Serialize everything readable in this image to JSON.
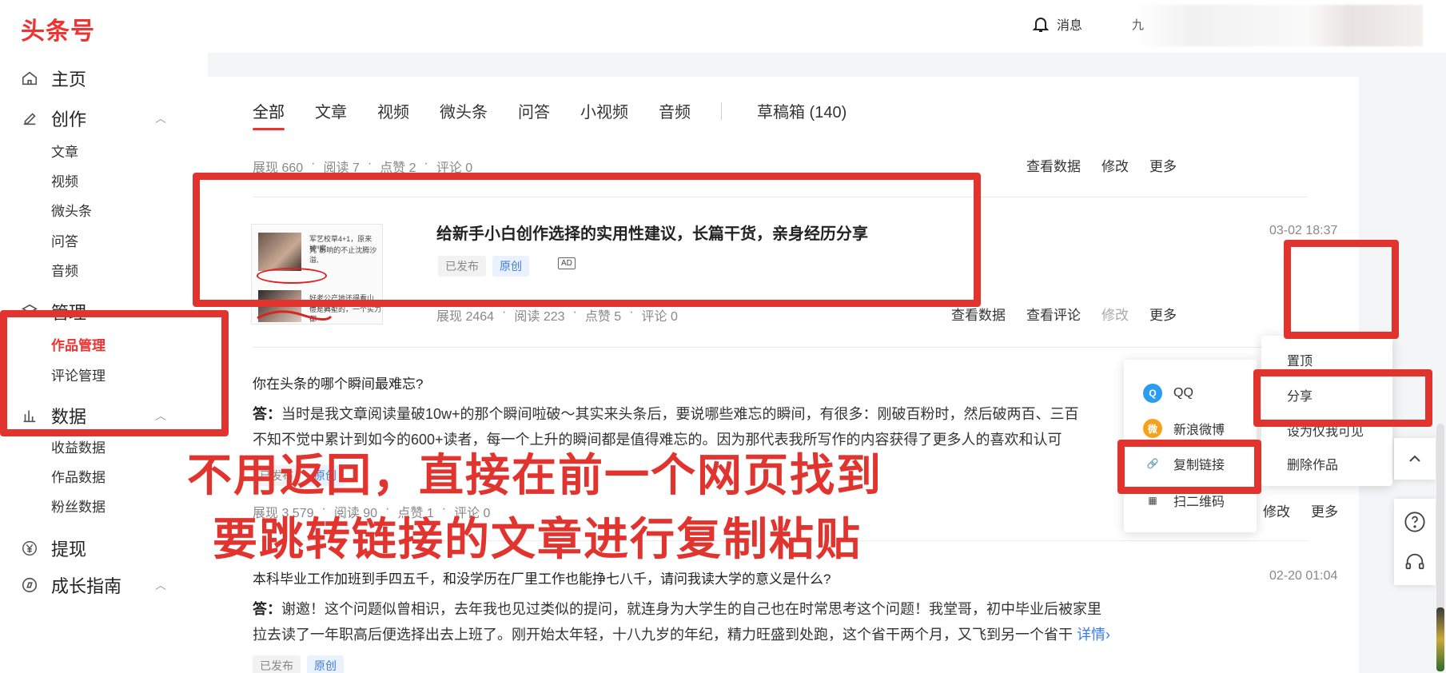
{
  "header": {
    "logo": "头条号",
    "messages_label": "消息",
    "clipped_text": "九"
  },
  "sidebar": {
    "home": "主页",
    "create": {
      "label": "创作",
      "items": [
        "文章",
        "视频",
        "微头条",
        "问答",
        "音频"
      ]
    },
    "manage": {
      "label": "管理",
      "items": [
        "作品管理",
        "评论管理"
      ]
    },
    "data": {
      "label": "数据",
      "items": [
        "收益数据",
        "作品数据",
        "粉丝数据"
      ]
    },
    "withdraw": "提现",
    "growth": "成长指南"
  },
  "tabs": [
    "全部",
    "文章",
    "视频",
    "微头条",
    "问答",
    "小视频",
    "音频"
  ],
  "drafts_tab": "草稿箱 (140)",
  "row1": {
    "stats": [
      "展现 660",
      "·",
      "阅读 7",
      "·",
      "点赞 2",
      "·",
      "评论 0"
    ],
    "actions": [
      "查看数据",
      "修改",
      "更多"
    ]
  },
  "post": {
    "title": "给新手小白创作选择的实用性建议，长篇干货，亲身经历分享",
    "status": "已发布",
    "original": "原创",
    "ad_label": "AD",
    "date": "03-02 18:37",
    "stats": [
      "展现 2464",
      "·",
      "阅读 223",
      "·",
      "点赞 5",
      "·",
      "评论 0"
    ],
    "actions": [
      "查看数据",
      "查看评论",
      "修改",
      "更多"
    ],
    "thumb_lines": [
      "军艺校草4+1，原来被\"腐",
      "咒\"影响的不止沈腾沙溢,",
      "好老公产地还得看山东！这3",
      "位是典型的，一个实力都"
    ]
  },
  "qa1": {
    "question": "你在头条的哪个瞬间最难忘?",
    "answer_label": "答：",
    "answer_line1": "当时是我文章阅读量破10w+的那个瞬间啦破～其实来头条后，要说哪些难忘的瞬间，有很多：刚破百粉时，然后破两百、三百",
    "answer_line2": "不知不觉中累计到如今的600+读者，每一个上升的瞬间都是值得难忘的。因为那代表我所写作的内容获得了更多人的喜欢和认可",
    "status": "已发布",
    "original": "原创",
    "stats": [
      "展现 3,579",
      "·",
      "阅读 90",
      "·",
      "点赞 1",
      "·",
      "评论 0"
    ],
    "actions": [
      "修改",
      "更多"
    ]
  },
  "qa2": {
    "question": "本科毕业工作加班到手四五千，和没学历在厂里工作也能挣七八千，请问我读大学的意义是什么?",
    "date": "02-20 01:04",
    "answer_label": "答：",
    "answer_line1": "谢邀！这个问题似曾相识，去年我也见过类似的提问，就连身为大学生的自己也在时常思考这个问题！我堂哥，初中毕业后被家里",
    "answer_line2": "拉去读了一年职高后便选择出去上班了。刚开始太年轻，十八九岁的年纪，精力旺盛到处跑，这个省干两个月，又飞到另一个省干",
    "detail": "详情",
    "status": "已发布",
    "original": "原创"
  },
  "share_menu": [
    "QQ",
    "新浪微博",
    "复制链接",
    "扫二维码"
  ],
  "more_menu": [
    "置顶",
    "分享",
    "设为仅我可见",
    "删除作品"
  ],
  "overlay": {
    "line1": "不用返回，直接在前一个网页找到",
    "line2": "要跳转链接的文章进行复制粘贴"
  },
  "colors": {
    "brand": "#e33333",
    "annotation": "#e2342f",
    "link": "#3b7bea"
  }
}
